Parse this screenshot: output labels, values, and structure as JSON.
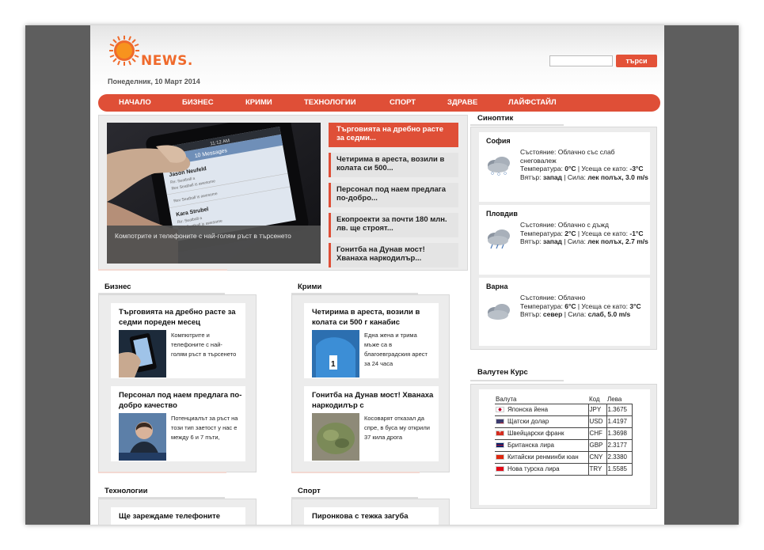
{
  "header": {
    "logo_text": "NEWS.",
    "date": "Понеделник, 10 Март 2014",
    "search_placeholder": "",
    "search_button": "търси"
  },
  "nav": [
    "НАЧАЛО",
    "БИЗНЕС",
    "КРИМИ",
    "ТЕХНОЛОГИИ",
    "СПОРТ",
    "ЗДРАВЕ",
    "ЛАЙФСТАЙЛ"
  ],
  "featured": {
    "caption": "Компотрите и телефоните с най-голям ръст в търсенето",
    "phone_screen": {
      "time": "11:12 AM",
      "header": "10 Messages",
      "contact1": "Jason Neufeld",
      "msg1a": "Re: Seatball a",
      "msg1b": "Rev Seatball is awesome",
      "msg1c": "Rev Seatball is awesome",
      "contact2": "Kara Strubel",
      "msg2a": "Re: Seatball a",
      "msg2b": "Rev Seatball is awesome"
    },
    "items": [
      "Търговията на дребно расте за седми...",
      "Четирима в ареста, возили в колата си 500...",
      "Персонал под наем предлага по-добро...",
      "Екопроекти за почти 180 млн. лв. ще строят...",
      "Гонитба на Дунав мост! Хванаха наркодилър..."
    ]
  },
  "sections": {
    "business": {
      "title": "Бизнес",
      "cards": [
        {
          "title": "Търговията на дребно расте за седми пореден месец",
          "text": "Компютрите и телефоните с най-голям ръст в търсенето"
        },
        {
          "title": "Персонал под наем предлага по-добро качество",
          "text": "Потенциалът за ръст на този тип заетост у нас е между 6 и 7 пъти,"
        }
      ]
    },
    "crime": {
      "title": "Крими",
      "cards": [
        {
          "title": "Четирима в ареста, возили в колата си 500 г канабис",
          "text": "Една жена и трима мъже са в благоевградския арест за 24 часа"
        },
        {
          "title": "Гонитба на Дунав мост! Хванаха наркодилър с",
          "text": "Косоварят отказал да спре, в буса му открили 37 кила дрога"
        }
      ]
    },
    "tech": {
      "title": "Технологии",
      "card_title": "Ще зареждаме телефоните"
    },
    "sport": {
      "title": "Спорт",
      "card_title": "Пиронкова с тежка загуба"
    }
  },
  "weather": {
    "title": "Синоптик",
    "cities": [
      {
        "name": "София",
        "state_label": "Състояние:",
        "state": "Облачно със слаб снеговалеж",
        "temp_label": "Температура:",
        "temp": "0°C",
        "feel_label": "Усеща се като:",
        "feel": "-3°C",
        "wind_label": "Вятър:",
        "wind_dir": "запад",
        "force_label": "Сила:",
        "wind": "лек полъх, 3.0 m/s",
        "icon": "snow-cloud-icon"
      },
      {
        "name": "Пловдив",
        "state_label": "Състояние:",
        "state": "Облачно с дъжд",
        "temp_label": "Температура:",
        "temp": "2°C",
        "feel_label": "Усеща се като:",
        "feel": "-1°C",
        "wind_label": "Вятър:",
        "wind_dir": "запад",
        "force_label": "Сила:",
        "wind": "лек полъх, 2.7 m/s",
        "icon": "rain-cloud-icon"
      },
      {
        "name": "Варна",
        "state_label": "Състояние:",
        "state": "Облачно",
        "temp_label": "Температура:",
        "temp": "6°C",
        "feel_label": "Усеща се като:",
        "feel": "3°C",
        "wind_label": "Вятър:",
        "wind_dir": "север",
        "force_label": "Сила:",
        "wind": "слаб, 5.0 m/s",
        "icon": "cloud-icon"
      }
    ]
  },
  "currency": {
    "title": "Валутен Курс",
    "headers": [
      "Валута",
      "Код",
      "Лева"
    ],
    "rows": [
      {
        "name": "Японска йена",
        "code": "JPY",
        "rate": "1.3675",
        "flag": "#ffffff"
      },
      {
        "name": "Щатски долар",
        "code": "USD",
        "rate": "1.4197",
        "flag": "#3c3b6e"
      },
      {
        "name": "Швейцарски франк",
        "code": "CHF",
        "rate": "1.3698",
        "flag": "#d52b1e"
      },
      {
        "name": "Британска лира",
        "code": "GBP",
        "rate": "2.3177",
        "flag": "#012169"
      },
      {
        "name": "Китайски ренминби юан",
        "code": "CNY",
        "rate": "2.3380",
        "flag": "#de2910"
      },
      {
        "name": "Нова турска лира",
        "code": "TRY",
        "rate": "1.5585",
        "flag": "#e30a17"
      }
    ]
  },
  "colors": {
    "accent": "#df4f37",
    "logo": "#ef6a2c",
    "frame": "#5e5e5e"
  }
}
